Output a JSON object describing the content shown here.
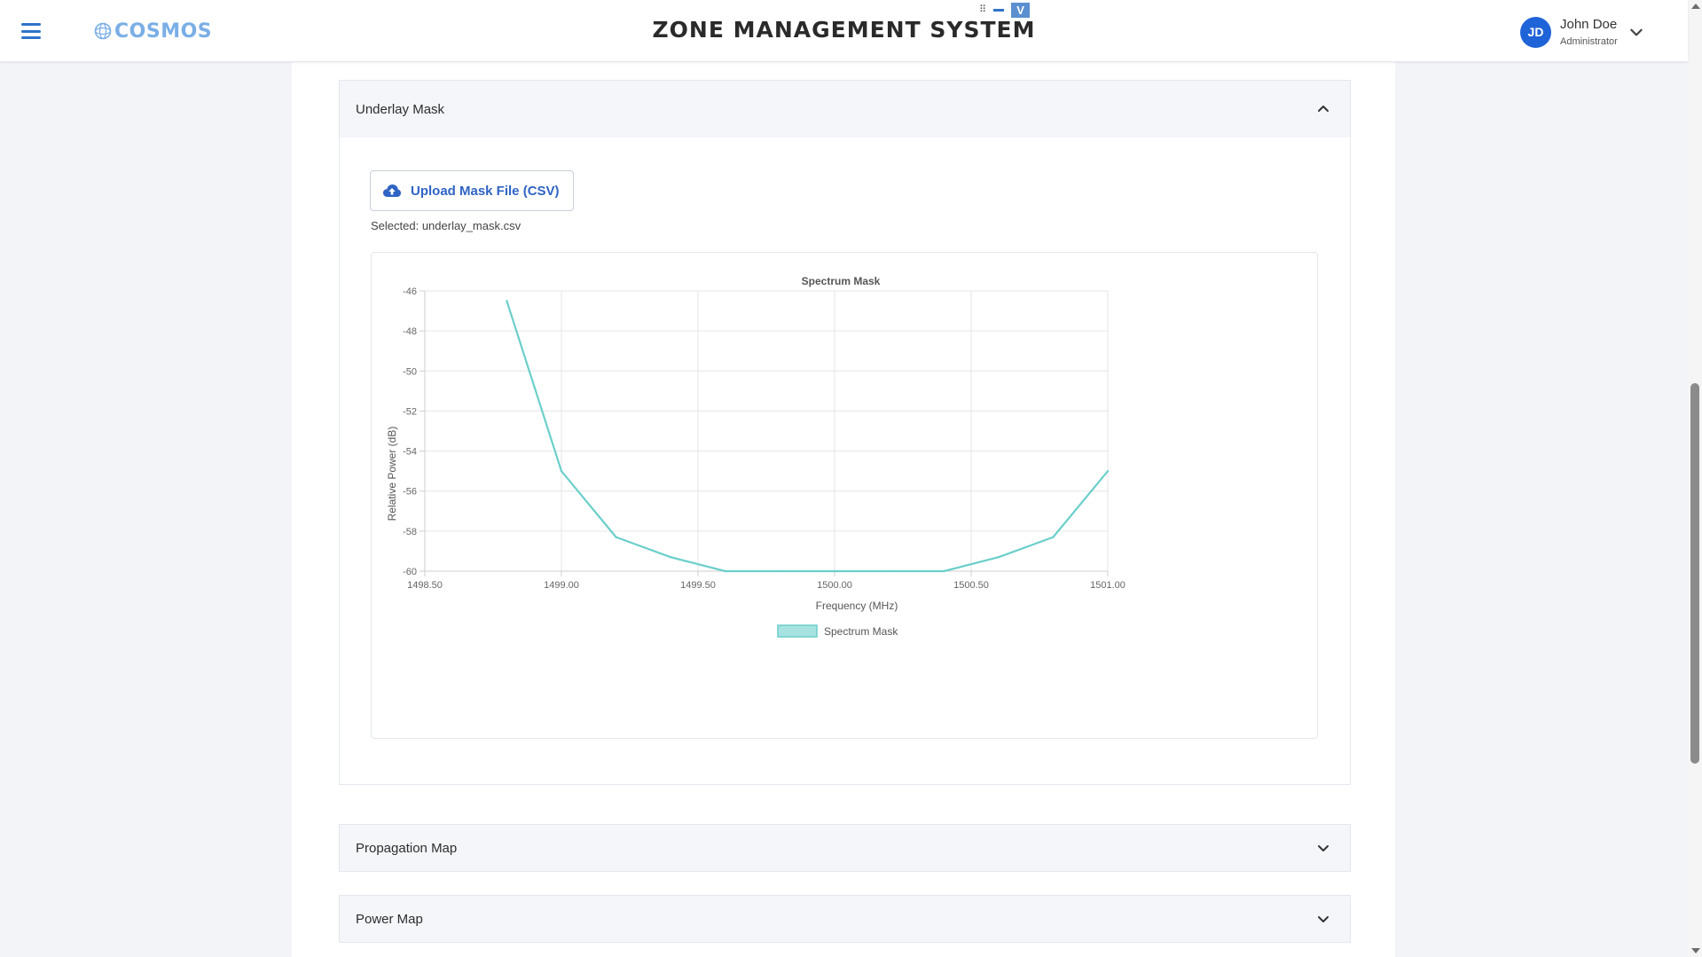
{
  "header": {
    "logo_text": "COSMOS",
    "title": "ZONE MANAGEMENT SYSTEM",
    "window_controls": {
      "grid_glyph": "⠿",
      "v_label": "V"
    },
    "user": {
      "initials": "JD",
      "name": "John Doe",
      "role": "Administrator"
    }
  },
  "panels": {
    "underlay": {
      "title": "Underlay Mask",
      "upload_label": "Upload Mask File (CSV)",
      "selected_text": "Selected: underlay_mask.csv"
    },
    "propagation": {
      "title": "Propagation Map"
    },
    "power": {
      "title": "Power Map"
    }
  },
  "colors": {
    "accent": "#2f73c9",
    "avatar": "#1f63d8",
    "series": "#6bcfcb",
    "series_fill": "#a6e3e0"
  },
  "icons": {
    "menu": "hamburger-icon",
    "upload": "cloud-upload-icon",
    "expanded": "chevron-up-icon",
    "collapsed": "chevron-down-icon",
    "user_menu": "chevron-down-icon"
  },
  "chart_data": {
    "type": "line",
    "title": "Spectrum Mask",
    "xlabel": "Frequency (MHz)",
    "ylabel": "Relative Power (dB)",
    "x": [
      1498.8,
      1499.0,
      1499.2,
      1499.4,
      1499.6,
      1499.8,
      1500.0,
      1500.2,
      1500.4,
      1500.6,
      1500.8,
      1501.0
    ],
    "series": [
      {
        "name": "Spectrum Mask",
        "values": [
          -46.5,
          -55.0,
          -58.3,
          -59.3,
          -60.0,
          -60.0,
          -60.0,
          -60.0,
          -60.0,
          -59.3,
          -58.3,
          -55.0
        ]
      }
    ],
    "xlim": [
      1498.5,
      1501.0
    ],
    "ylim": [
      -60,
      -46
    ],
    "x_ticks": [
      "1498.50",
      "1499.00",
      "1499.50",
      "1500.00",
      "1500.50",
      "1501.00"
    ],
    "y_ticks": [
      "-46",
      "-48",
      "-50",
      "-52",
      "-54",
      "-56",
      "-58",
      "-60"
    ],
    "grid": true,
    "legend": "bottom"
  }
}
